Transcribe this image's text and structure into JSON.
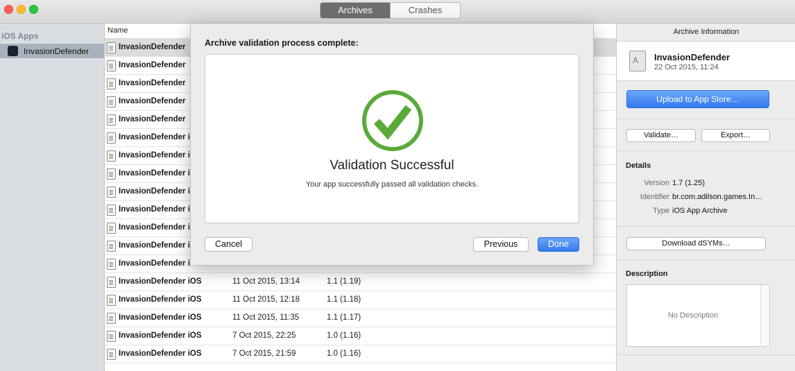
{
  "window": {
    "tabs": [
      {
        "label": "Archives",
        "active": true
      },
      {
        "label": "Crashes",
        "active": false
      }
    ]
  },
  "sidebar": {
    "heading": "iOS Apps",
    "items": [
      {
        "label": "InvasionDefender",
        "selected": true
      }
    ]
  },
  "list": {
    "header_name": "Name",
    "rows": [
      {
        "name": "InvasionDefender",
        "date": "",
        "version": "",
        "selected": true
      },
      {
        "name": "InvasionDefender",
        "date": "",
        "version": ""
      },
      {
        "name": "InvasionDefender",
        "date": "",
        "version": ""
      },
      {
        "name": "InvasionDefender",
        "date": "",
        "version": ""
      },
      {
        "name": "InvasionDefender",
        "date": "",
        "version": ""
      },
      {
        "name": "InvasionDefender i",
        "date": "",
        "version": ""
      },
      {
        "name": "InvasionDefender i",
        "date": "",
        "version": ""
      },
      {
        "name": "InvasionDefender i",
        "date": "",
        "version": ""
      },
      {
        "name": "InvasionDefender i",
        "date": "",
        "version": ""
      },
      {
        "name": "InvasionDefender i",
        "date": "",
        "version": ""
      },
      {
        "name": "InvasionDefender i",
        "date": "",
        "version": ""
      },
      {
        "name": "InvasionDefender i",
        "date": "",
        "version": ""
      },
      {
        "name": "InvasionDefender iOS",
        "date": "",
        "version": ""
      },
      {
        "name": "InvasionDefender iOS",
        "date": "11 Oct 2015, 13:14",
        "version": "1.1 (1.19)"
      },
      {
        "name": "InvasionDefender iOS",
        "date": "11 Oct 2015, 12:18",
        "version": "1.1 (1.18)"
      },
      {
        "name": "InvasionDefender iOS",
        "date": "11 Oct 2015, 11:35",
        "version": "1.1 (1.17)"
      },
      {
        "name": "InvasionDefender iOS",
        "date": "7 Oct 2015, 22:25",
        "version": "1.0 (1.16)"
      },
      {
        "name": "InvasionDefender iOS",
        "date": "7 Oct 2015, 21:59",
        "version": "1.0 (1.16)"
      }
    ]
  },
  "info_panel": {
    "title": "Archive Information",
    "archive_name": "InvasionDefender",
    "archive_date": "22 Oct 2015, 11:24",
    "upload_button": "Upload to App Store…",
    "validate_button": "Validate…",
    "export_button": "Export…",
    "details_heading": "Details",
    "details": [
      {
        "key": "Version",
        "value": "1.7 (1.25)"
      },
      {
        "key": "Identifier",
        "value": "br.com.adilson.games.In…"
      },
      {
        "key": "Type",
        "value": "iOS App Archive"
      }
    ],
    "download_dsyms_button": "Download dSYMs…",
    "description_heading": "Description",
    "description_placeholder": "No Description"
  },
  "dialog": {
    "title": "Archive validation process complete:",
    "heading": "Validation Successful",
    "message": "Your app successfully passed all validation checks.",
    "cancel_button": "Cancel",
    "previous_button": "Previous",
    "done_button": "Done",
    "icon": "checkmark-circle-icon",
    "success_color": "#5aaa3a"
  }
}
